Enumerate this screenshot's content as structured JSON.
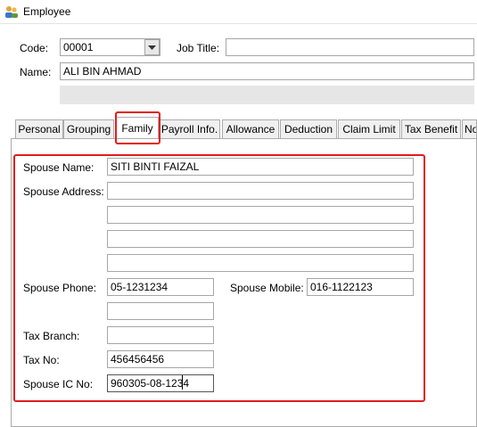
{
  "window": {
    "title": "Employee",
    "icon": "users-icon"
  },
  "header": {
    "code_label": "Code:",
    "code_value": "00001",
    "job_title_label": "Job Title:",
    "job_title_value": "",
    "name_label": "Name:",
    "name_value": "ALI BIN AHMAD"
  },
  "tabs": [
    {
      "label": "Personal"
    },
    {
      "label": "Grouping"
    },
    {
      "label": "Family",
      "active": true
    },
    {
      "label": "Payroll Info."
    },
    {
      "label": "Allowance"
    },
    {
      "label": "Deduction"
    },
    {
      "label": "Claim Limit"
    },
    {
      "label": "Tax Benefit"
    },
    {
      "label": "No"
    }
  ],
  "family": {
    "spouse_name_label": "Spouse Name:",
    "spouse_name_value": "SITI BINTI FAIZAL",
    "spouse_address_label": "Spouse Address:",
    "spouse_address_lines": [
      "",
      "",
      "",
      ""
    ],
    "spouse_phone_label": "Spouse Phone:",
    "spouse_phone_value": "05-1231234",
    "spouse_phone_2_value": "",
    "spouse_mobile_label": "Spouse Mobile:",
    "spouse_mobile_value": "016-1122123",
    "tax_branch_label": "Tax Branch:",
    "tax_branch_value": "",
    "tax_no_label": "Tax No:",
    "tax_no_value": "456456456",
    "spouse_ic_label": "Spouse IC No:",
    "spouse_ic_value": "960305-08-1234"
  },
  "colors": {
    "highlight": "#e11d1d",
    "readonly_bar": "#e6e6e6",
    "tab_bg": "#f0f0f0"
  }
}
